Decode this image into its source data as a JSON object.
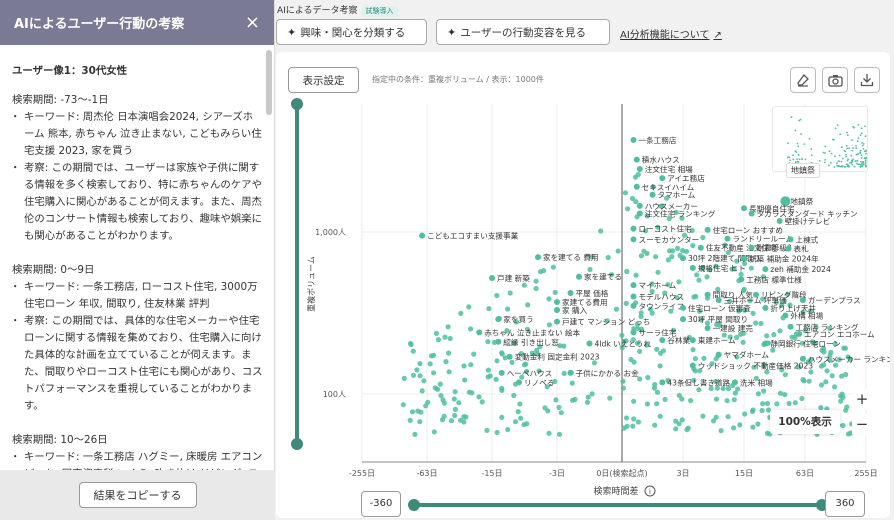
{
  "panel": {
    "title": "AIによるユーザー行動の考察",
    "close_icon": "×",
    "persona": "ユーザー像1：30代女性",
    "sections": [
      {
        "period": "検索期間: -73〜-1日",
        "keyword": "キーワード: 周杰伦 日本演唱会2024, シアーズホーム 熊本, 赤ちゃん 泣き止まない, こどもみらい住宅支援 2023, 家を買う",
        "insight": "考察: この期間では、ユーザーは家族や子供に関する情報を多く検索しており、特に赤ちゃんのケアや住宅購入に関心があることが伺えます。また、周杰伦のコンサート情報も検索しており、趣味や娯楽にも関心があることがわかります。"
      },
      {
        "period": "検索期間: 0〜9日",
        "keyword": "キーワード: 一条工務店, ローコスト住宅, 3000万 住宅ローン 年収, 間取り, 住友林業 評判",
        "insight": "考察: この期間では、具体的な住宅メーカーや住宅ローンに関する情報を集めており、住宅購入に向けた具体的な計画を立てていることが伺えます。また、間取りやローコスト住宅にも関心があり、コストパフォーマンスを重視していることがわかります。"
      },
      {
        "period": "検索期間: 10〜26日",
        "keyword": "キーワード: 一条工務店 ハグミー, 床暖房 エアコン どっち, 固定資産税 いくら, 吹き抜け リビング, スキップフロア",
        "insight": ""
      }
    ],
    "copy_button": "結果をコピーする"
  },
  "topbar": {
    "title": "AIによるデータ考察",
    "badge": "試験導入",
    "btn_classify": "興味・関心を分類する",
    "btn_behavior": "ユーザーの行動変容を見る",
    "about_link": "AI分析機能について"
  },
  "chart_toolbar": {
    "display_settings": "表示設定",
    "condition": "指定中の条件：重複ボリューム / 表示：1000件"
  },
  "range": {
    "min": "-360",
    "max": "360"
  },
  "zoom": {
    "level": "100%表示"
  },
  "minimap_label": "地鎮祭",
  "colors": {
    "accent": "#3f8a78",
    "point": "#4fbf9f"
  },
  "chart_data": {
    "type": "scatter",
    "xlabel": "検索時間差",
    "ylabel": "重複ボリューム",
    "x_ticks": [
      "-255日",
      "-63日",
      "-15日",
      "-3日",
      "0日(検索起点)",
      "3日",
      "15日",
      "63日",
      "255日"
    ],
    "y_ticks": [
      "1,000人",
      "100人"
    ],
    "y_scale": "log",
    "labeled_points": [
      {
        "label": "一条工務店",
        "x": 0.3,
        "y": 3700
      },
      {
        "label": "積水ハウス",
        "x": 0.4,
        "y": 2800
      },
      {
        "label": "注文住宅 相場",
        "x": 0.5,
        "y": 2450
      },
      {
        "label": "アイエ務店",
        "x": 1.5,
        "y": 2150
      },
      {
        "label": "セキスイハイム",
        "x": 0.4,
        "y": 1900
      },
      {
        "label": "タマホーム",
        "x": 1.0,
        "y": 1700
      },
      {
        "label": "地鎮祭",
        "x": 40,
        "y": 1550
      },
      {
        "label": "ハウスメーカー",
        "x": 0.5,
        "y": 1450
      },
      {
        "label": "長期優良住宅",
        "x": 15,
        "y": 1400
      },
      {
        "label": "注文住宅 ランキング",
        "x": 0.5,
        "y": 1300
      },
      {
        "label": "タカラスタンダード キッチン",
        "x": 18,
        "y": 1300
      },
      {
        "label": "壁掛けテレビ",
        "x": 35,
        "y": 1170
      },
      {
        "label": "ローコスト住宅",
        "x": 0.3,
        "y": 1050
      },
      {
        "label": "住宅ローン おすすめ",
        "x": 6,
        "y": 1030
      },
      {
        "label": "こどもエコすまい支援事業",
        "x": -70,
        "y": 950
      },
      {
        "label": "スーモカウンター",
        "x": 0.3,
        "y": 900
      },
      {
        "label": "ランドリールーム",
        "x": 10,
        "y": 910
      },
      {
        "label": "上棟式",
        "x": 45,
        "y": 900
      },
      {
        "label": "住友不動産 注文住宅",
        "x": 5,
        "y": 800
      },
      {
        "label": "耐震等級3",
        "x": 18,
        "y": 800
      },
      {
        "label": "表札",
        "x": 43,
        "y": 790
      },
      {
        "label": "家を建てる 費用",
        "x": -5,
        "y": 700
      },
      {
        "label": "30坪 2階建て 間取り",
        "x": 3,
        "y": 690
      },
      {
        "label": "新築 補助金 2024年",
        "x": 15,
        "y": 685
      },
      {
        "label": "規格住宅 ヒト",
        "x": 4,
        "y": 600
      },
      {
        "label": "zeh 補助金 2024",
        "x": 25,
        "y": 590
      },
      {
        "label": "戸建 新築",
        "x": -15,
        "y": 520
      },
      {
        "label": "家を建てる",
        "x": -1.5,
        "y": 530
      },
      {
        "label": "マイホーム",
        "x": 0.3,
        "y": 470
      },
      {
        "label": "工務店 標準仕様",
        "x": 14,
        "y": 510
      },
      {
        "label": "平屋 価格",
        "x": -2,
        "y": 420
      },
      {
        "label": "モデルハウス",
        "x": 0.3,
        "y": 400
      },
      {
        "label": "間取り 人気",
        "x": 6,
        "y": 410
      },
      {
        "label": "リビング階段",
        "x": 20,
        "y": 410
      },
      {
        "label": "家建てる費用",
        "x": -3,
        "y": 370
      },
      {
        "label": "三井ホーム 坪単価",
        "x": 8,
        "y": 380
      },
      {
        "label": "ガーデンプラス",
        "x": 60,
        "y": 380
      },
      {
        "label": "家 購入",
        "x": -3,
        "y": 330
      },
      {
        "label": "タウンライフ",
        "x": 0.3,
        "y": 350
      },
      {
        "label": "住宅ローン 仮審査",
        "x": 3,
        "y": 340
      },
      {
        "label": "折り上げ天井",
        "x": 25,
        "y": 340
      },
      {
        "label": "外構 相場",
        "x": 40,
        "y": 305
      },
      {
        "label": "家を買う",
        "x": -13,
        "y": 290
      },
      {
        "label": "戸建て マンション どっち",
        "x": -3,
        "y": 280
      },
      {
        "label": "30坪 平屋 間取り",
        "x": 3,
        "y": 290
      },
      {
        "label": "一建設 建売",
        "x": 6,
        "y": 255
      },
      {
        "label": "工務店 ランキング",
        "x": 45,
        "y": 260
      },
      {
        "label": "赤ちゃん 泣き止まない 絵本",
        "x": -20,
        "y": 240
      },
      {
        "label": "サーラ住宅",
        "x": 0.3,
        "y": 240
      },
      {
        "label": "エアコン エコホーム",
        "x": 55,
        "y": 235
      },
      {
        "label": "綛縁 引き出し窓",
        "x": -13,
        "y": 210
      },
      {
        "label": "4ldk いえとうれ",
        "x": -1,
        "y": 205
      },
      {
        "label": "谷林業",
        "x": 1.5,
        "y": 215
      },
      {
        "label": "東建ホーム",
        "x": 4,
        "y": 215
      },
      {
        "label": "静岡銀行 住宅ローン",
        "x": 25,
        "y": 205
      },
      {
        "label": "変動金利 固定金利 2023",
        "x": -10,
        "y": 170
      },
      {
        "label": "ヤマダホーム",
        "x": 8,
        "y": 175
      },
      {
        "label": "ハウスメーカー ランキング",
        "x": 60,
        "y": 165
      },
      {
        "label": "ウッドショック 不動産価格 2023",
        "x": 4,
        "y": 150
      },
      {
        "label": "ヘーベハウス",
        "x": -12,
        "y": 135
      },
      {
        "label": "子供にかかる お金",
        "x": -2,
        "y": 135
      },
      {
        "label": "リノベる",
        "x": -8,
        "y": 118
      },
      {
        "label": "43条但し書き道路",
        "x": 1.5,
        "y": 118
      },
      {
        "label": "洗米 相場",
        "x": 12,
        "y": 118
      }
    ]
  }
}
